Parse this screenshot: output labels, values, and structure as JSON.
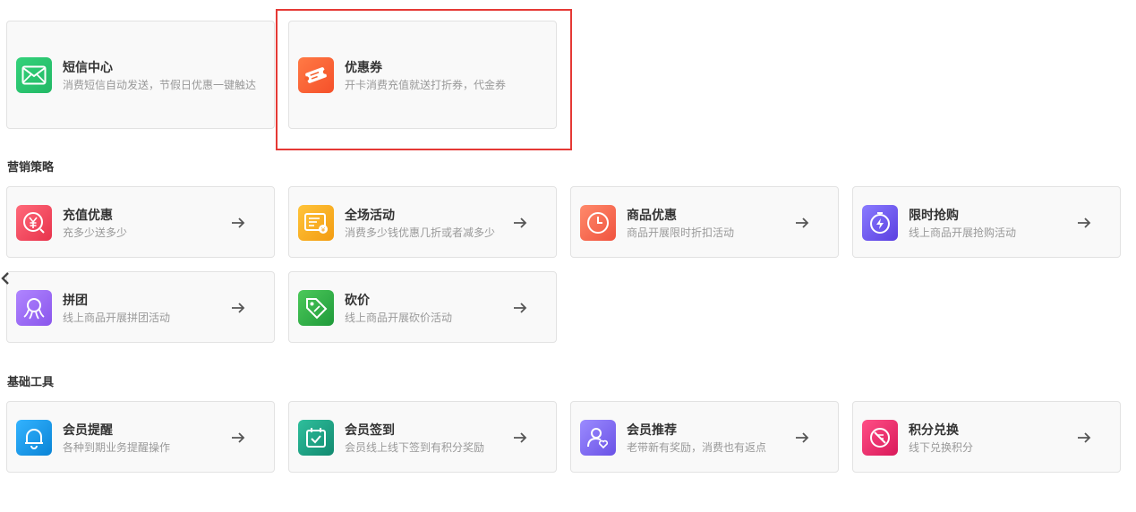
{
  "top_cards": [
    {
      "title": "短信中心",
      "desc": "消费短信自动发送，节假日优惠一键触达",
      "icon": "envelope-icon",
      "color": "#2ecc71"
    },
    {
      "title": "优惠券",
      "desc": "开卡消费充值就送打折券，代金券",
      "icon": "ticket-icon",
      "color": "#ff6b3d"
    }
  ],
  "sections": {
    "marketing": {
      "title": "营销策略"
    },
    "basic_tools": {
      "title": "基础工具"
    }
  },
  "marketing_cards": [
    {
      "title": "充值优惠",
      "desc": "充多少送多少",
      "icon": "yen-coin-icon",
      "color": "#f24b5f"
    },
    {
      "title": "全场活动",
      "desc": "消费多少钱优惠几折或者减多少",
      "icon": "receipt-icon",
      "color": "#f7b21b"
    },
    {
      "title": "商品优惠",
      "desc": "商品开展限时折扣活动",
      "icon": "clock-icon",
      "color": "#f6705a"
    },
    {
      "title": "限时抢购",
      "desc": "线上商品开展抢购活动",
      "icon": "lightning-stopwatch-icon",
      "color": "#6d5cf0"
    },
    {
      "title": "拼团",
      "desc": "线上商品开展拼团活动",
      "icon": "group-icon",
      "color": "#9b6cf2"
    },
    {
      "title": "砍价",
      "desc": "线上商品开展砍价活动",
      "icon": "tag-icon",
      "color": "#35b04a"
    }
  ],
  "tool_cards": [
    {
      "title": "会员提醒",
      "desc": "各种到期业务提醒操作",
      "icon": "bell-icon",
      "color": "#1e9be8"
    },
    {
      "title": "会员签到",
      "desc": "会员线上线下签到有积分奖励",
      "icon": "calendar-check-icon",
      "color": "#1fa58a"
    },
    {
      "title": "会员推荐",
      "desc": "老带新有奖励，消费也有返点",
      "icon": "user-heart-icon",
      "color": "#7e6df2"
    },
    {
      "title": "积分兑换",
      "desc": "线下兑换积分",
      "icon": "exchange-icon",
      "color": "#e9336f"
    }
  ]
}
